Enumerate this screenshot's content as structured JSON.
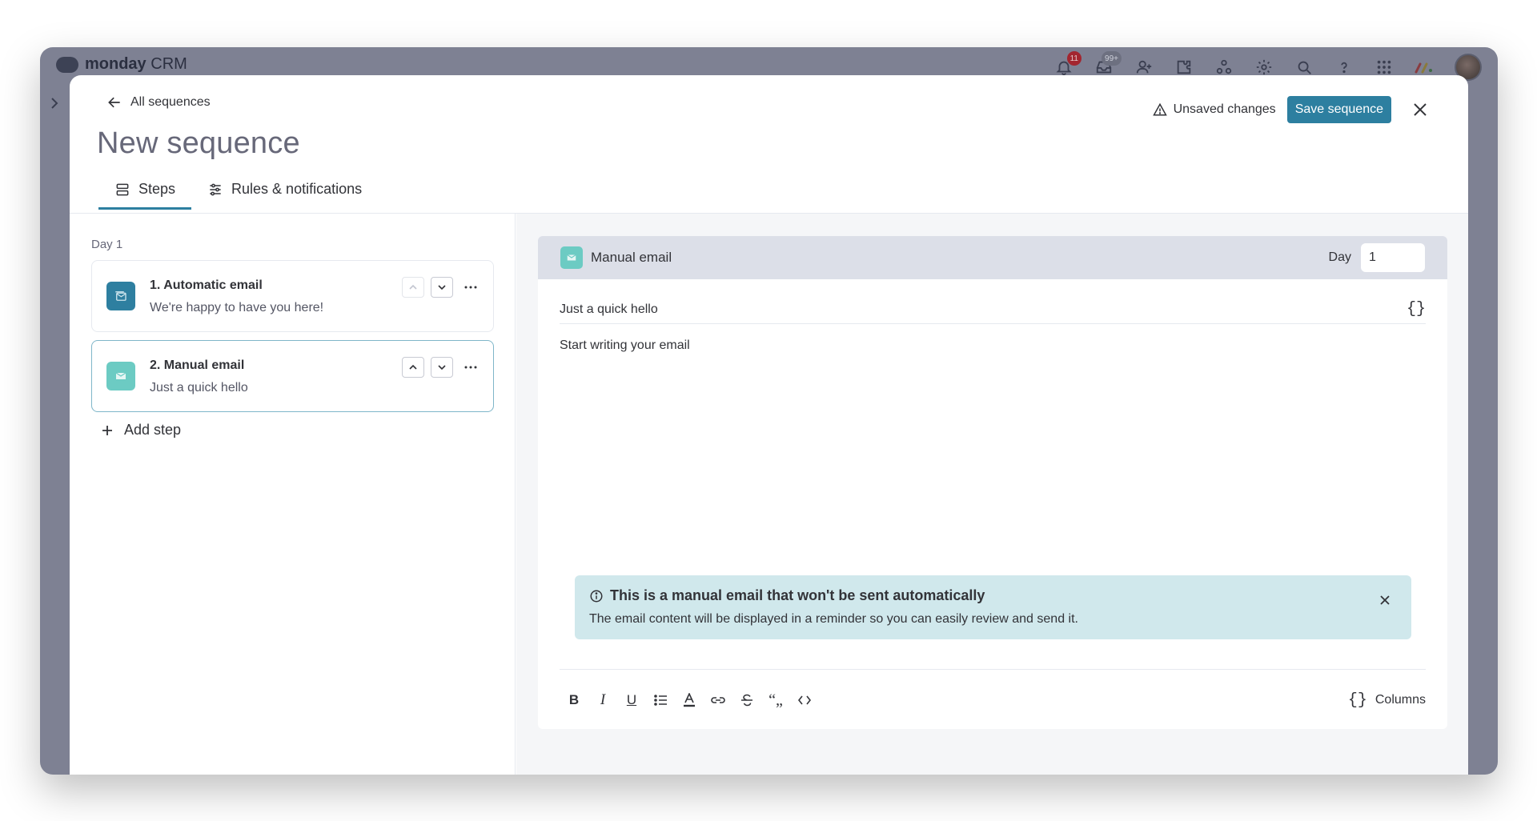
{
  "app": {
    "logo_word": "monday",
    "logo_product": "CRM",
    "notifications_badge": "11",
    "inbox_badge": "99+"
  },
  "header": {
    "back_label": "All sequences",
    "title": "New sequence",
    "unsaved_label": "Unsaved changes",
    "save_label": "Save sequence"
  },
  "tabs": [
    {
      "label": "Steps",
      "active": true,
      "icon": "list-icon"
    },
    {
      "label": "Rules & notifications",
      "active": false,
      "icon": "sliders-icon"
    }
  ],
  "steps_panel": {
    "day_label": "Day 1",
    "steps": [
      {
        "title": "1. Automatic email",
        "subtitle": "We're happy to have you here!",
        "icon": "automatic-email-icon",
        "color": "#2e7fa0"
      },
      {
        "title": "2. Manual email",
        "subtitle": "Just a quick hello",
        "icon": "manual-email-icon",
        "color": "#6ccbc3"
      }
    ],
    "add_step_label": "Add step"
  },
  "editor": {
    "title": "Manual email",
    "day_label": "Day",
    "day_value": "1",
    "subject": "Just a quick hello",
    "body_placeholder": "Start writing your email",
    "banner": {
      "title": "This is a manual email that won't be sent automatically",
      "body": "The email content will be displayed in a reminder so you can easily review and send it."
    },
    "columns_label": "Columns"
  },
  "colors": {
    "accent": "#2d7fa0",
    "manual_email": "#6ccbc3",
    "banner_bg": "#d0e8ec"
  }
}
